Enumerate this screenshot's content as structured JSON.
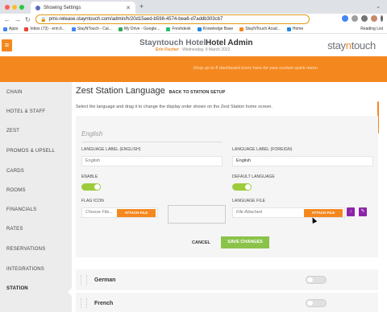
{
  "browser": {
    "tab_title": "Showing Settings",
    "url": "pms-release.stayntouch.com/admin/h/20d15aed-b598-4574-bea6-d7addb303cb7",
    "bookmarks": [
      {
        "label": "Apps",
        "color": "#4285f4"
      },
      {
        "label": "Inbox (73) - erin.fi...",
        "color": "#ea4335"
      },
      {
        "label": "StayNTouch - Cal...",
        "color": "#4285f4"
      },
      {
        "label": "My Drive - Google...",
        "color": "#34a853"
      },
      {
        "label": "Freshdesk",
        "color": "#25c16f"
      },
      {
        "label": "Knowledge Base",
        "color": "#1e88e5"
      },
      {
        "label": "StayNTouch Acad...",
        "color": "#f4881f"
      },
      {
        "label": "Home",
        "color": "#1e88e5"
      }
    ],
    "reading_list": "Reading List"
  },
  "header": {
    "hotel_name": "Stayntouch Hotel",
    "admin_title": "Hotel Admin",
    "user_name": "Erin Fischer",
    "date": "Wednesday, 9 March 2022",
    "logo_left": "stay",
    "logo_n": "n",
    "logo_right": "touch",
    "hint": "Drop up to 8 dashboard icons here for your custom quick menu"
  },
  "sidebar": {
    "items": [
      "CHAIN",
      "HOTEL & STAFF",
      "ZEST",
      "PROMOS & UPSELL",
      "CARDS",
      "ROOMS",
      "FINANCIALS",
      "RATES",
      "RESERVATIONS",
      "INTEGRATIONS",
      "STATION"
    ],
    "active": "STATION"
  },
  "main": {
    "title": "Zest Station Language",
    "back_link": "BACK TO STATION SETUP",
    "description": "Select the language and drag it to change the display order shown on the Zest Station home screen.",
    "edit": {
      "language": "English",
      "label_english_label": "LANGUAGE LABEL (ENGLISH)",
      "label_english_value": "English",
      "label_foreign_label": "LANGUAGE LABEL (FOREIGN)",
      "label_foreign_value": "English",
      "enable_label": "ENABLE",
      "default_label": "DEFAULT LANGUAGE",
      "flag_icon_label": "FLAG ICON",
      "flag_icon_placeholder": "Choose File...",
      "attach_file": "ATTACH FILE",
      "language_file_label": "LANGUAGE FILE",
      "language_file_value": "File Attached",
      "cancel": "CANCEL",
      "save": "SAVE CHANGES"
    },
    "languages": [
      "German",
      "French"
    ]
  },
  "colors": {
    "accent": "#f4881f",
    "toggle_on": "#9ccc3c",
    "save": "#8bc34a",
    "purple": "#8e24aa"
  }
}
